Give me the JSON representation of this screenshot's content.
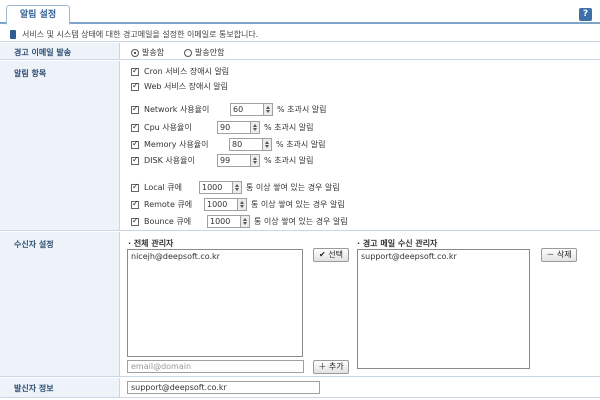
{
  "tabs": {
    "active_label": "알림 설정"
  },
  "help": {
    "icon": "help-icon",
    "label": "?"
  },
  "description": "서비스 및 시스템 상태에 대한 경고메일을 설정한 이메일로 통보합니다.",
  "email_sending": {
    "label": "경고 이메일 발송",
    "options": [
      {
        "label": "발송함",
        "selected": true
      },
      {
        "label": "발송안함",
        "selected": false
      }
    ]
  },
  "alert_items": {
    "label": "알림 항목",
    "service": [
      {
        "label": "Cron 서비스 장애시 알림",
        "checked": true
      },
      {
        "label": "Web 서비스 장애시 알림",
        "checked": true
      }
    ],
    "usage": [
      {
        "label": "Network 사용율이",
        "value": "60",
        "suffix": "% 초과시 알림",
        "checked": true
      },
      {
        "label": "Cpu 사용율이",
        "value": "90",
        "suffix": "% 초과시 알림",
        "checked": true
      },
      {
        "label": "Memory 사용율이",
        "value": "80",
        "suffix": "% 초과시 알림",
        "checked": true
      },
      {
        "label": "DISK 사용율이",
        "value": "99",
        "suffix": "% 초과시 알림",
        "checked": true
      }
    ],
    "queue": [
      {
        "label": "Local 큐에",
        "value": "1000",
        "suffix": "통 이상 쌓여 있는 경우 알림",
        "checked": true
      },
      {
        "label": "Remote 큐에",
        "value": "1000",
        "suffix": "통 이상 쌓여 있는 경우 알림",
        "checked": true
      },
      {
        "label": "Bounce 큐에",
        "value": "1000",
        "suffix": "통 이상 쌓여 있는 경우 알림",
        "checked": true
      }
    ]
  },
  "recipients": {
    "label": "수신자 설정",
    "all_admins": {
      "title": "· 전체 관리자",
      "items": [
        "nicejh@deepsoft.co.kr"
      ]
    },
    "select_button": "✔ 선택",
    "alert_admins": {
      "title": "· 경고 메일 수신 관리자",
      "items": [
        "support@deepsoft.co.kr"
      ]
    },
    "delete_button": "－ 삭제",
    "email_input": {
      "value": "",
      "placeholder": "email@domain"
    },
    "add_button": "＋ 추가"
  },
  "sender": {
    "label": "발신자 정보",
    "value": "support@deepsoft.co.kr"
  }
}
